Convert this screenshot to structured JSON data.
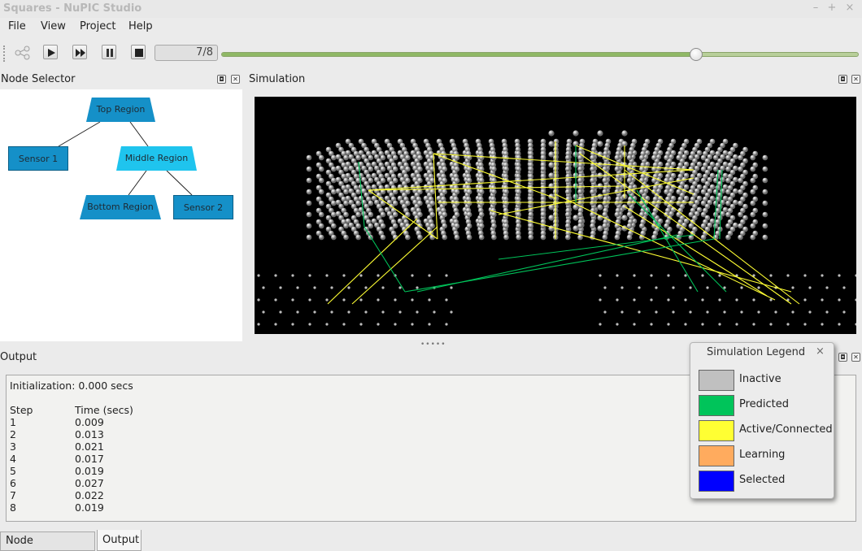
{
  "window": {
    "title": "Squares - NuPIC Studio",
    "controls": [
      "–",
      "+",
      "×"
    ]
  },
  "menu": {
    "items": [
      "File",
      "View",
      "Project",
      "Help"
    ]
  },
  "toolbar": {
    "step_text": "7/8",
    "progress": 0.745
  },
  "node_selector": {
    "title": "Node Selector",
    "nodes": {
      "top": "Top Region",
      "sensor1": "Sensor 1",
      "middle": "Middle Region",
      "bottom": "Bottom Region",
      "sensor2": "Sensor 2"
    },
    "colors": {
      "node": "#1590c8",
      "selected": "#1fc4ee"
    }
  },
  "simulation": {
    "title": "Simulation"
  },
  "output": {
    "title": "Output",
    "init_line": "Initialization: 0.000 secs",
    "col_step": "Step",
    "col_time": "Time (secs)",
    "rows": [
      {
        "step": "1",
        "time": "0.009"
      },
      {
        "step": "2",
        "time": "0.013"
      },
      {
        "step": "3",
        "time": "0.021"
      },
      {
        "step": "4",
        "time": "0.017"
      },
      {
        "step": "5",
        "time": "0.019"
      },
      {
        "step": "6",
        "time": "0.027"
      },
      {
        "step": "7",
        "time": "0.022"
      },
      {
        "step": "8",
        "time": "0.019"
      }
    ]
  },
  "tabs": [
    "Node Information",
    "Output"
  ],
  "legend": {
    "title": "Simulation Legend",
    "close": "×",
    "items": [
      {
        "label": "Inactive",
        "color": "#c0c0c0"
      },
      {
        "label": "Predicted",
        "color": "#00c45a"
      },
      {
        "label": "Active/Connected",
        "color": "#ffff33"
      },
      {
        "label": "Learning",
        "color": "#ffab5e"
      },
      {
        "label": "Selected",
        "color": "#0000ff"
      }
    ]
  }
}
